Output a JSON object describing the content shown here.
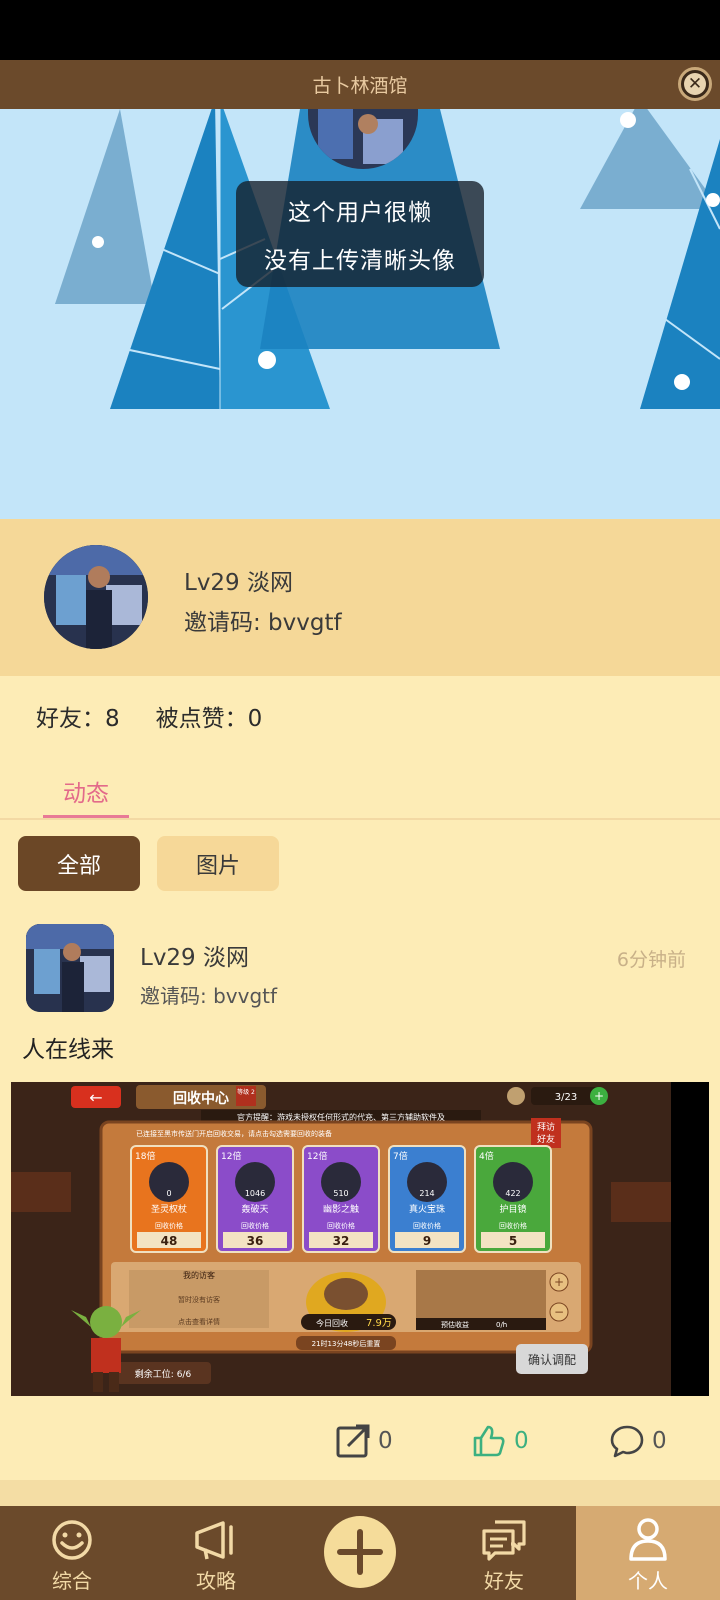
{
  "app": {
    "title": "古卜林酒馆"
  },
  "banner": {
    "tooltip_line1": "这个用户很懒",
    "tooltip_line2": "没有上传清晰头像"
  },
  "profile": {
    "name": "Lv29 淡网",
    "invite_code": "邀请码: bvvgtf"
  },
  "stats": {
    "friends": "好友：8",
    "likes": "被点赞：0"
  },
  "tabs": {
    "active": "动态"
  },
  "filters": {
    "all": "全部",
    "images": "图片"
  },
  "post": {
    "author": "Lv29 淡网",
    "invite_code": "邀请码: bvvgtf",
    "time": "6分钟前",
    "text": "人在线来",
    "image": {
      "header": "回收中心",
      "level_badge": "等级 2",
      "notice": "官方提醒：游戏未授权任何形式的代充、第三方辅助软件及",
      "counter": "3/23",
      "visit_badge": "拜访好友",
      "subtitle": "已连接至黑市传送门开启回收交易，请点击勾选需要回收的装备",
      "price_label": "回收价格",
      "items": [
        {
          "mult": "18倍",
          "count": "0",
          "name": "圣灵权杖",
          "price": "48",
          "color": "#e8741e"
        },
        {
          "mult": "12倍",
          "count": "1046",
          "name": "轰破天",
          "price": "36",
          "color": "#8b4cc9"
        },
        {
          "mult": "12倍",
          "count": "510",
          "name": "幽影之触",
          "price": "32",
          "color": "#8b4cc9"
        },
        {
          "mult": "7倍",
          "count": "214",
          "name": "真火宝珠",
          "price": "9",
          "color": "#3b7fd0"
        },
        {
          "mult": "4倍",
          "count": "422",
          "name": "护目镜",
          "price": "5",
          "color": "#4aa83c"
        }
      ],
      "visitors_title": "我的访客",
      "visitors_empty": "暂时没有访客",
      "visitors_link": "点击查看详情",
      "today_recycle": "今日回收",
      "today_amount": "7.9万",
      "estimate": "预估收益",
      "estimate_val": "0/h",
      "reset_timer": "21时13分48秒后重置",
      "slots": "剩余工位: 6/6",
      "confirm": "确认调配"
    },
    "shares": "0",
    "likes": "0",
    "comments": "0"
  },
  "nav": {
    "general": "综合",
    "guide": "攻略",
    "friends": "好友",
    "me": "个人"
  },
  "colors": {
    "brown": "#6b4a2b",
    "accent_pink": "#e36a8a",
    "like_green": "#3cb080"
  }
}
